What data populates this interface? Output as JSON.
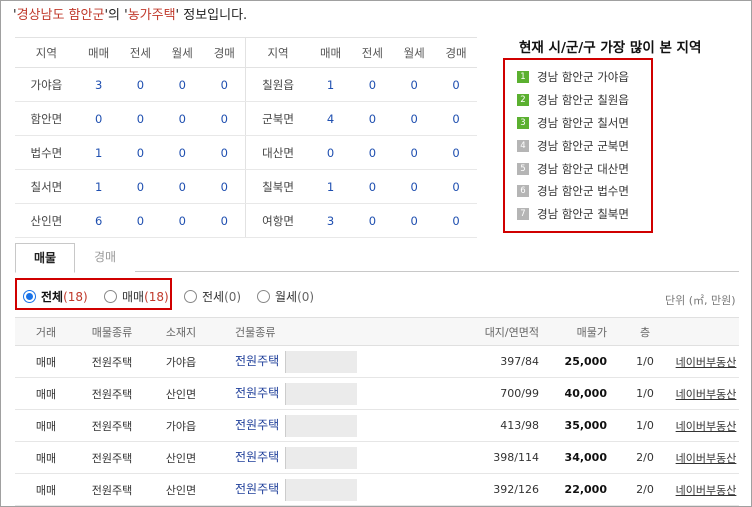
{
  "headline": {
    "q1": "'",
    "region": "경상남도 함안군",
    "q2": "'의 '",
    "type": "농가주택",
    "q3": "' 정보입니다."
  },
  "region_table": {
    "headers": [
      "지역",
      "매매",
      "전세",
      "월세",
      "경매"
    ],
    "rows": [
      {
        "left": [
          "가야읍",
          "3",
          "0",
          "0",
          "0"
        ],
        "right": [
          "칠원읍",
          "1",
          "0",
          "0",
          "0"
        ]
      },
      {
        "left": [
          "함안면",
          "0",
          "0",
          "0",
          "0"
        ],
        "right": [
          "군북면",
          "4",
          "0",
          "0",
          "0"
        ]
      },
      {
        "left": [
          "법수면",
          "1",
          "0",
          "0",
          "0"
        ],
        "right": [
          "대산면",
          "0",
          "0",
          "0",
          "0"
        ]
      },
      {
        "left": [
          "칠서면",
          "1",
          "0",
          "0",
          "0"
        ],
        "right": [
          "칠북면",
          "1",
          "0",
          "0",
          "0"
        ]
      },
      {
        "left": [
          "산인면",
          "6",
          "0",
          "0",
          "0"
        ],
        "right": [
          "여항면",
          "3",
          "0",
          "0",
          "0"
        ]
      }
    ]
  },
  "top_viewed": {
    "title": "현재 시/군/구 가장 많이 본 지역",
    "items": [
      {
        "rank": "1",
        "name": "경남 함안군 가야읍",
        "color": "#5bb030"
      },
      {
        "rank": "2",
        "name": "경남 함안군 칠원읍",
        "color": "#5bb030"
      },
      {
        "rank": "3",
        "name": "경남 함안군 칠서면",
        "color": "#5bb030"
      },
      {
        "rank": "4",
        "name": "경남 함안군 군북면",
        "color": "#b5b5b5"
      },
      {
        "rank": "5",
        "name": "경남 함안군 대산면",
        "color": "#b5b5b5"
      },
      {
        "rank": "6",
        "name": "경남 함안군 법수면",
        "color": "#b5b5b5"
      },
      {
        "rank": "7",
        "name": "경남 함안군 칠북면",
        "color": "#b5b5b5"
      }
    ]
  },
  "tabs": {
    "active": "매물",
    "inactive": "경매"
  },
  "filters": [
    {
      "label": "전체",
      "count": "(18)",
      "selected": true
    },
    {
      "label": "매매",
      "count": "(18)",
      "selected": false
    },
    {
      "label": "전세",
      "count": "(0)",
      "selected": false
    },
    {
      "label": "월세",
      "count": "(0)",
      "selected": false
    }
  ],
  "unit_label": "단위 (㎡, 만원)",
  "listing": {
    "headers": [
      "거래",
      "매물종류",
      "소재지",
      "건물종류",
      "대지/연면적",
      "매물가",
      "층",
      ""
    ],
    "rows": [
      {
        "deal": "매매",
        "kind": "전원주택",
        "loc": "가야읍",
        "building": "전원주택",
        "area": "397/84",
        "price": "25,000",
        "floor": "1/0",
        "link": "네이버부동산"
      },
      {
        "deal": "매매",
        "kind": "전원주택",
        "loc": "산인면",
        "building": "전원주택",
        "area": "700/99",
        "price": "40,000",
        "floor": "1/0",
        "link": "네이버부동산"
      },
      {
        "deal": "매매",
        "kind": "전원주택",
        "loc": "가야읍",
        "building": "전원주택",
        "area": "413/98",
        "price": "35,000",
        "floor": "1/0",
        "link": "네이버부동산"
      },
      {
        "deal": "매매",
        "kind": "전원주택",
        "loc": "산인면",
        "building": "전원주택",
        "area": "398/114",
        "price": "34,000",
        "floor": "2/0",
        "link": "네이버부동산"
      },
      {
        "deal": "매매",
        "kind": "전원주택",
        "loc": "산인면",
        "building": "전원주택",
        "area": "392/126",
        "price": "22,000",
        "floor": "2/0",
        "link": "네이버부동산"
      }
    ]
  }
}
